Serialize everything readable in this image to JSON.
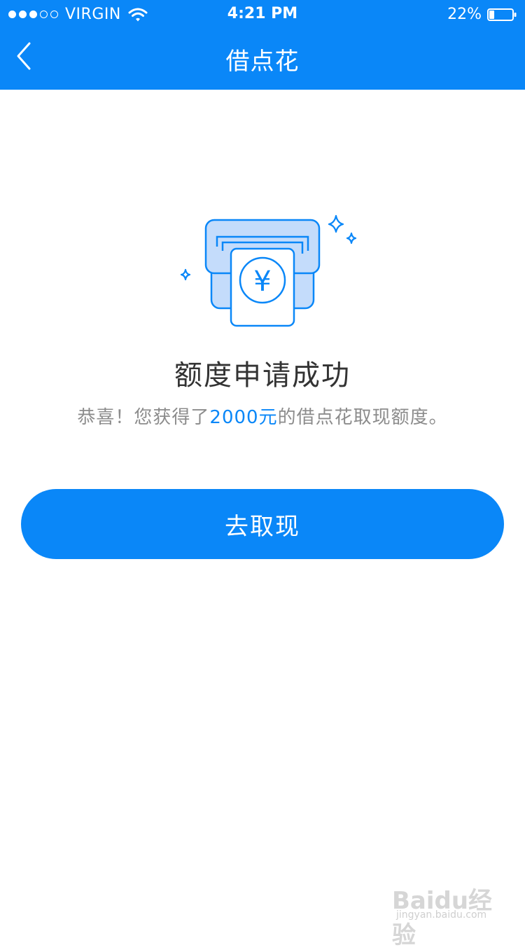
{
  "status_bar": {
    "carrier": "VIRGIN",
    "signal_bars_filled": 3,
    "signal_bars_total": 5,
    "time": "4:21 PM",
    "battery_percent": "22%",
    "battery_level": 0.22
  },
  "nav": {
    "title": "借点花",
    "back_icon": "chevron-left-icon"
  },
  "result": {
    "heading": "额度申请成功",
    "sub_prefix": "恭喜！您获得了",
    "sub_amount": "2000元",
    "sub_suffix": "的借点花取现额度。"
  },
  "illustration": {
    "icon": "cash-dispense-icon",
    "symbol": "¥"
  },
  "action": {
    "button_label": "去取现"
  },
  "watermark": {
    "brand": "Baidu经验",
    "url": "jingyan.baidu.com"
  },
  "colors": {
    "primary": "#0a87f8",
    "heading": "#333333",
    "subtext": "#8c8c8c",
    "illustration_fill": "#c4dcfb"
  }
}
